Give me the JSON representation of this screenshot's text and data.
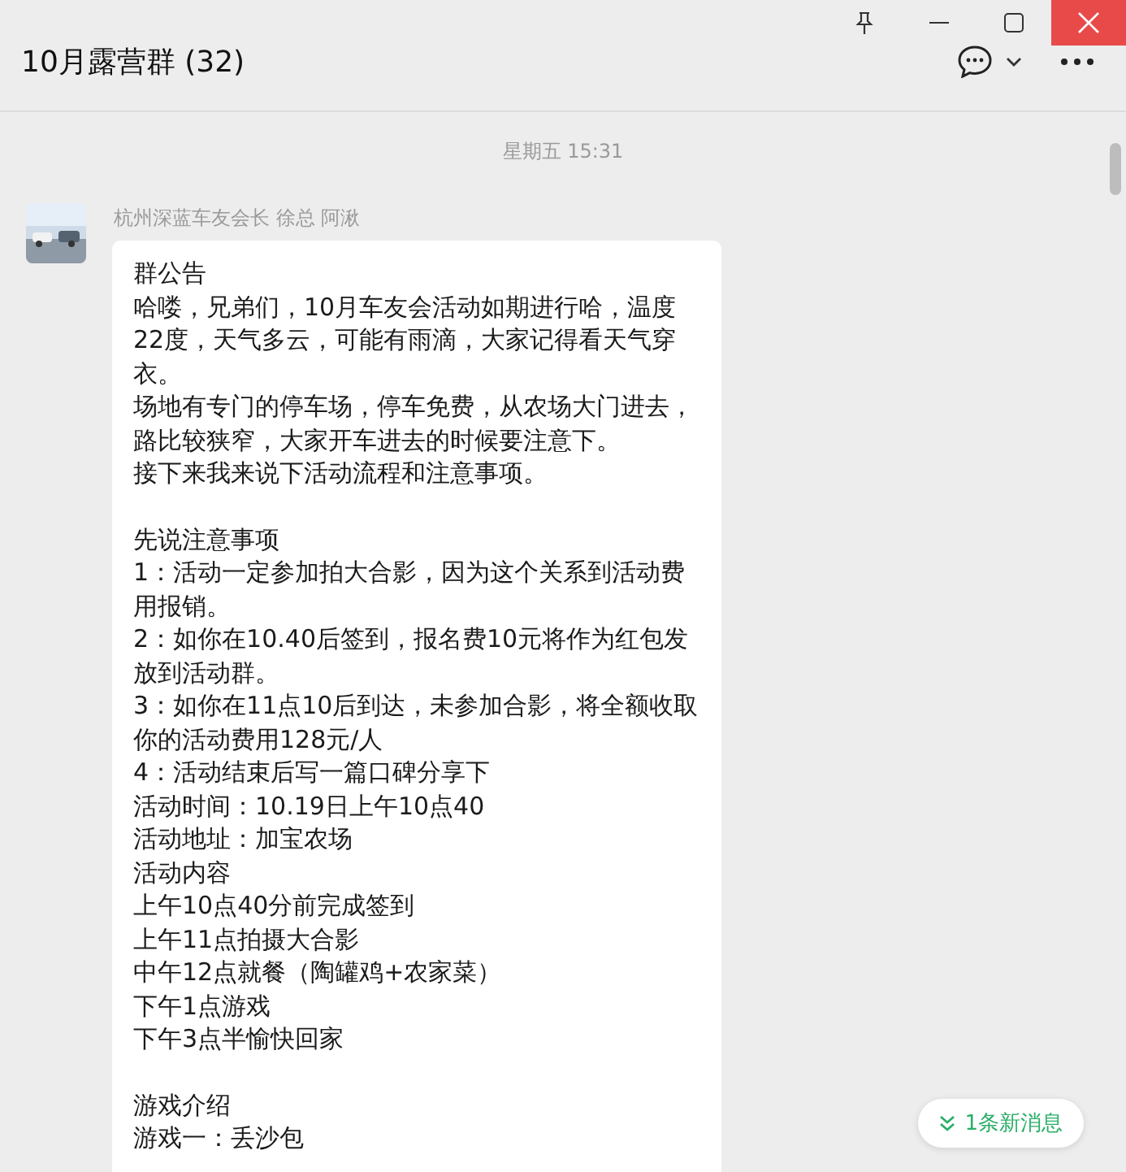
{
  "window": {
    "title": "10月露营群 (32)"
  },
  "timestamp": "星期五 15:31",
  "message": {
    "sender": "杭州深蓝车友会长 徐总 阿湫",
    "sections": [
      [
        "群公告",
        "哈喽，兄弟们，10月车友会活动如期进行哈，温度22度，天气多云，可能有雨滴，大家记得看天气穿衣。",
        "场地有专门的停车场，停车免费，从农场大门进去，路比较狭窄，大家开车进去的时候要注意下。",
        "接下来我来说下活动流程和注意事项。"
      ],
      [
        "先说注意事项",
        "1：活动一定参加拍大合影，因为这个关系到活动费用报销。",
        "2：如你在10.40后签到，报名费10元将作为红包发放到活动群。",
        "3：如你在11点10后到达，未参加合影，将全额收取你的活动费用128元/人",
        "4：活动结束后写一篇口碑分享下",
        "活动时间：10.19日上午10点40",
        "活动地址：加宝农场",
        "活动内容",
        "上午10点40分前完成签到",
        "上午11点拍摄大合影",
        "中午12点就餐（陶罐鸡+农家菜）",
        "下午1点游戏",
        "下午3点半愉快回家"
      ],
      [
        "游戏介绍",
        "游戏一：丢沙包"
      ]
    ]
  },
  "new_messages": {
    "label": "1条新消息"
  }
}
